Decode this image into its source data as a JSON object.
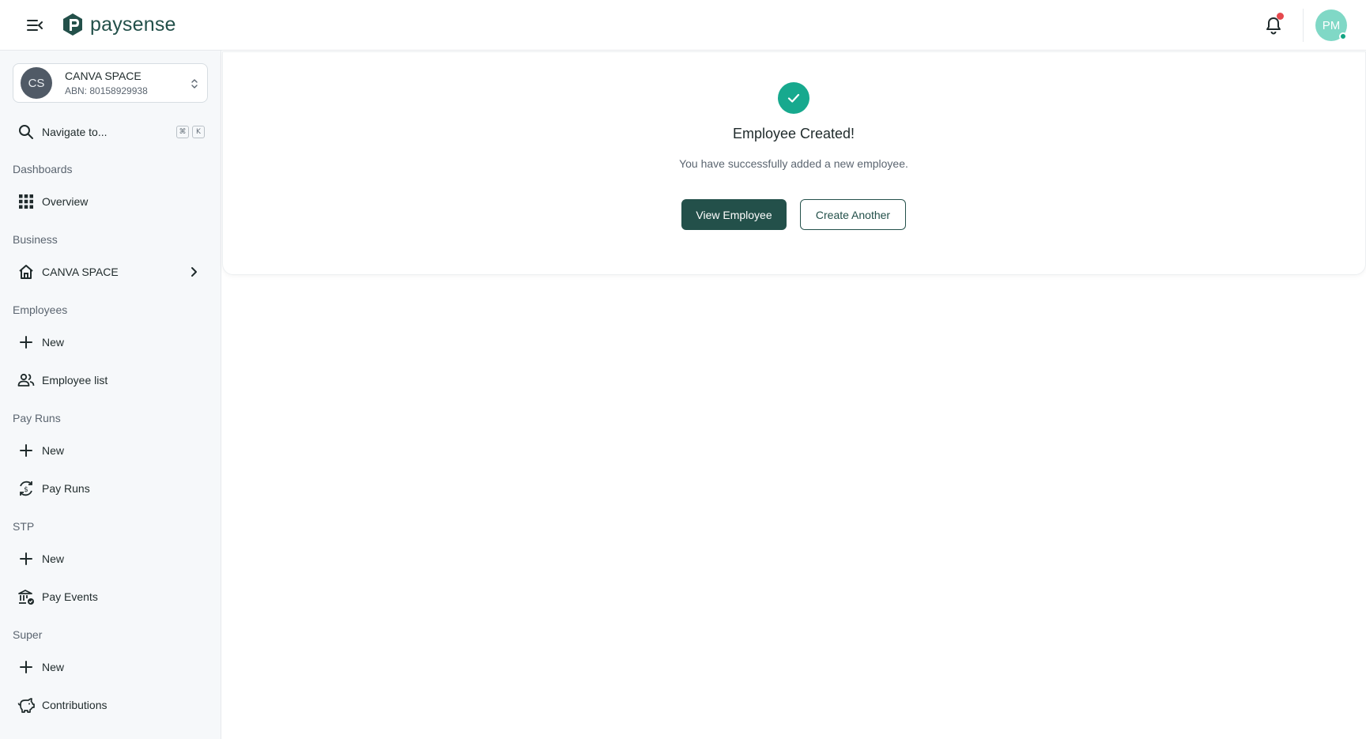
{
  "header": {
    "app_name": "paysense",
    "menu_icon": "menu-collapse-icon",
    "notifications_icon": "bell-icon",
    "user_initials": "PM"
  },
  "sidebar": {
    "business": {
      "initials": "CS",
      "name": "CANVA SPACE",
      "abn": "ABN: 80158929938"
    },
    "search": {
      "label": "Navigate to...",
      "shortcut_keys": [
        "⌘",
        "K"
      ]
    },
    "sections": [
      {
        "title": "Dashboards",
        "items": [
          {
            "label": "Overview",
            "icon": "grid-icon"
          }
        ]
      },
      {
        "title": "Business",
        "items": [
          {
            "label": "CANVA SPACE",
            "icon": "home-icon",
            "has_chevron": true
          }
        ]
      },
      {
        "title": "Employees",
        "items": [
          {
            "label": "New",
            "icon": "plus-icon"
          },
          {
            "label": "Employee list",
            "icon": "people-icon"
          }
        ]
      },
      {
        "title": "Pay Runs",
        "items": [
          {
            "label": "New",
            "icon": "plus-icon"
          },
          {
            "label": "Pay Runs",
            "icon": "currency-exchange-icon"
          }
        ]
      },
      {
        "title": "STP",
        "items": [
          {
            "label": "New",
            "icon": "plus-icon"
          },
          {
            "label": "Pay Events",
            "icon": "bank-check-icon"
          }
        ]
      },
      {
        "title": "Super",
        "items": [
          {
            "label": "New",
            "icon": "plus-icon"
          },
          {
            "label": "Contributions",
            "icon": "piggy-bank-icon"
          }
        ]
      }
    ]
  },
  "main": {
    "title": "Employee Created!",
    "message": "You have successfully added a new employee.",
    "primary_button": "View Employee",
    "secondary_button": "Create Another",
    "icon": "check-circle-icon"
  },
  "colors": {
    "brand": "#23504a",
    "success": "#17a98e",
    "notification_dot": "#e5484d",
    "avatar_user": "#80d8c6"
  }
}
